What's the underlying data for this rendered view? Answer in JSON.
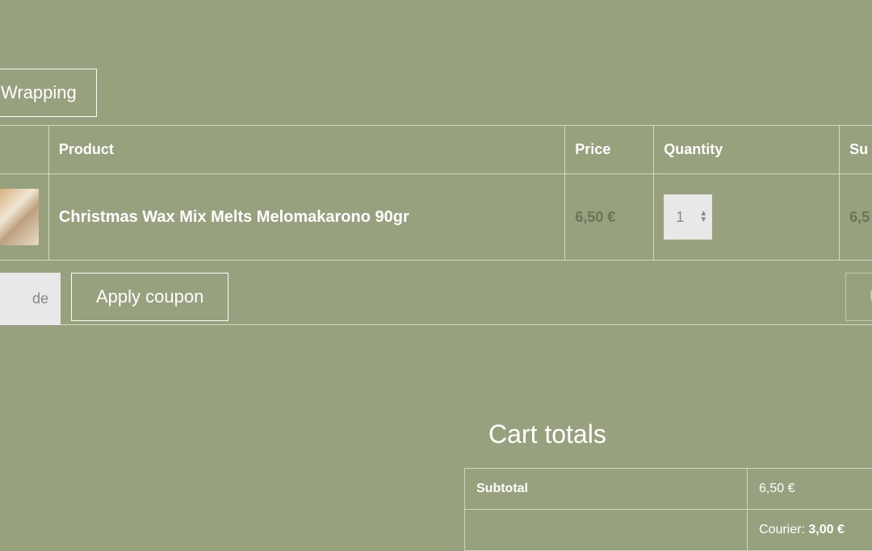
{
  "buttons": {
    "wrapping_label": "Wrapping",
    "apply_coupon_label": "Apply coupon",
    "update_cart_label": "Upda"
  },
  "table": {
    "headers": {
      "product": "Product",
      "price": "Price",
      "quantity": "Quantity",
      "subtotal": "Su"
    },
    "rows": [
      {
        "product_name": "Christmas Wax Mix Melts Melomakarono 90gr",
        "price": "6,50 €",
        "quantity": "1",
        "subtotal": "6,5"
      }
    ]
  },
  "coupon": {
    "placeholder": "de"
  },
  "totals": {
    "heading": "Cart totals",
    "subtotal_label": "Subtotal",
    "subtotal_value": "6,50 €",
    "shipping_label": "Courier: ",
    "shipping_value": "3,00 €"
  }
}
